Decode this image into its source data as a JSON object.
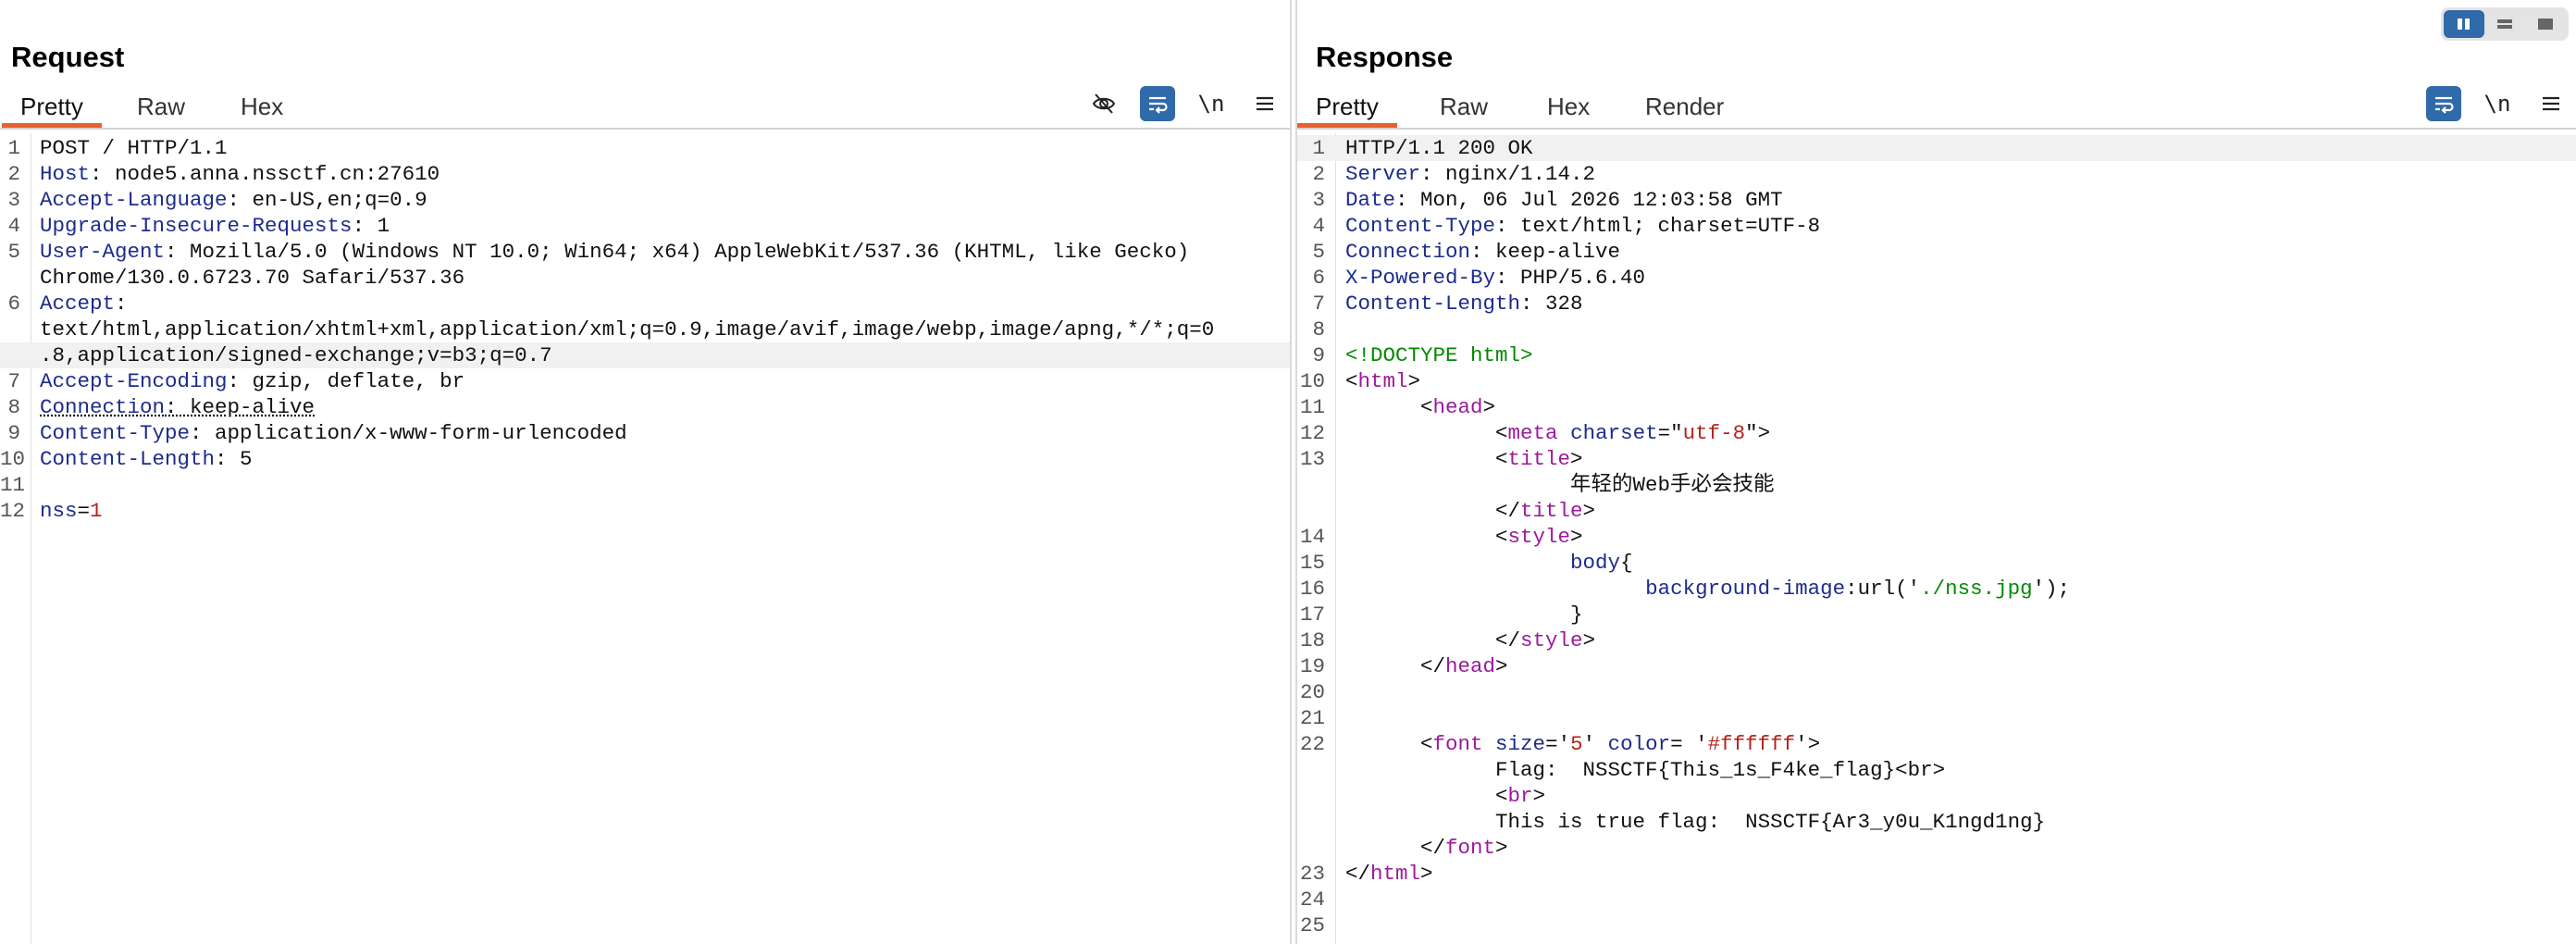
{
  "layout_switcher": {
    "icons": [
      "split-vertical-icon",
      "split-horizontal-icon",
      "single-pane-icon"
    ],
    "active": 0
  },
  "request": {
    "title": "Request",
    "tabs": [
      "Pretty",
      "Raw",
      "Hex"
    ],
    "active_tab": "Pretty",
    "tools": {
      "hide": "eye-slash-icon",
      "wrap": "wrap-icon",
      "newline": "\\n",
      "menu": "menu-icon"
    },
    "lines": [
      {
        "n": "1",
        "parts": [
          [
            "v",
            "POST / HTTP/1.1"
          ]
        ]
      },
      {
        "n": "2",
        "parts": [
          [
            "k",
            "Host"
          ],
          [
            "v",
            ": node5.anna.nssctf.cn:27610"
          ]
        ]
      },
      {
        "n": "3",
        "parts": [
          [
            "k",
            "Accept-Language"
          ],
          [
            "v",
            ": en-US,en;q=0.9"
          ]
        ]
      },
      {
        "n": "4",
        "parts": [
          [
            "k",
            "Upgrade-Insecure-Requests"
          ],
          [
            "v",
            ": 1"
          ]
        ]
      },
      {
        "n": "5",
        "parts": [
          [
            "k",
            "User-Agent"
          ],
          [
            "v",
            ": Mozilla/5.0 (Windows NT 10.0; Win64; x64) AppleWebKit/537.36 (KHTML, like Gecko)"
          ]
        ]
      },
      {
        "n": "",
        "parts": [
          [
            "v",
            "Chrome/130.0.6723.70 Safari/537.36"
          ]
        ]
      },
      {
        "n": "6",
        "parts": [
          [
            "k",
            "Accept"
          ],
          [
            "v",
            ":"
          ]
        ]
      },
      {
        "n": "",
        "parts": [
          [
            "v",
            "text/html,application/xhtml+xml,application/xml;q=0.9,image/avif,image/webp,image/apng,*/*;q=0"
          ]
        ]
      },
      {
        "n": "",
        "parts": [
          [
            "v",
            ".8,application/signed-exchange;v=b3;q=0.7"
          ]
        ],
        "hl": true
      },
      {
        "n": "7",
        "parts": [
          [
            "k",
            "Accept-Encoding"
          ],
          [
            "v",
            ": gzip, deflate, br"
          ]
        ]
      },
      {
        "n": "8",
        "parts": [
          [
            "k",
            "Connection"
          ],
          [
            "v",
            ": keep-alive"
          ]
        ],
        "dotted": true
      },
      {
        "n": "9",
        "parts": [
          [
            "k",
            "Content-Type"
          ],
          [
            "v",
            ": application/x-www-form-urlencoded"
          ]
        ]
      },
      {
        "n": "10",
        "parts": [
          [
            "k",
            "Content-Length"
          ],
          [
            "v",
            ": 5"
          ]
        ]
      },
      {
        "n": "11",
        "parts": []
      },
      {
        "n": "12",
        "parts": [
          [
            "k",
            "nss"
          ],
          [
            "v",
            "="
          ],
          [
            "num",
            "1"
          ]
        ]
      }
    ]
  },
  "response": {
    "title": "Response",
    "tabs": [
      "Pretty",
      "Raw",
      "Hex",
      "Render"
    ],
    "active_tab": "Pretty",
    "tools": {
      "wrap": "wrap-icon",
      "newline": "\\n",
      "menu": "menu-icon"
    },
    "lines": [
      {
        "n": "1",
        "parts": [
          [
            "v",
            "HTTP/1.1 200 OK"
          ]
        ],
        "hl": true
      },
      {
        "n": "2",
        "parts": [
          [
            "k",
            "Server"
          ],
          [
            "v",
            ": nginx/1.14.2"
          ]
        ]
      },
      {
        "n": "3",
        "parts": [
          [
            "k",
            "Date"
          ],
          [
            "v",
            ": Mon, 06 Jul 2026 12:03:58 GMT"
          ]
        ]
      },
      {
        "n": "4",
        "parts": [
          [
            "k",
            "Content-Type"
          ],
          [
            "v",
            ": text/html; charset=UTF-8"
          ]
        ]
      },
      {
        "n": "5",
        "parts": [
          [
            "k",
            "Connection"
          ],
          [
            "v",
            ": keep-alive"
          ]
        ]
      },
      {
        "n": "6",
        "parts": [
          [
            "k",
            "X-Powered-By"
          ],
          [
            "v",
            ": PHP/5.6.40"
          ]
        ]
      },
      {
        "n": "7",
        "parts": [
          [
            "k",
            "Content-Length"
          ],
          [
            "v",
            ": 328"
          ]
        ]
      },
      {
        "n": "8",
        "parts": []
      },
      {
        "n": "9",
        "parts": [
          [
            "doctype",
            "<!DOCTYPE html>"
          ]
        ]
      },
      {
        "n": "10",
        "parts": [
          [
            "v",
            "<"
          ],
          [
            "tag",
            "html"
          ],
          [
            "v",
            ">"
          ]
        ]
      },
      {
        "n": "11",
        "parts": [
          [
            "v",
            "      <"
          ],
          [
            "tag",
            "head"
          ],
          [
            "v",
            ">"
          ]
        ]
      },
      {
        "n": "12",
        "parts": [
          [
            "v",
            "            <"
          ],
          [
            "tag",
            "meta"
          ],
          [
            "v",
            " "
          ],
          [
            "attr",
            "charset"
          ],
          [
            "v",
            "=\""
          ],
          [
            "strr",
            "utf-8"
          ],
          [
            "v",
            "\">"
          ]
        ]
      },
      {
        "n": "13",
        "parts": [
          [
            "v",
            "            <"
          ],
          [
            "tag",
            "title"
          ],
          [
            "v",
            ">"
          ]
        ]
      },
      {
        "n": "",
        "parts": [
          [
            "v",
            "                  年轻的Web手必会技能"
          ]
        ]
      },
      {
        "n": "",
        "parts": [
          [
            "v",
            "            </"
          ],
          [
            "tag",
            "title"
          ],
          [
            "v",
            ">"
          ]
        ]
      },
      {
        "n": "14",
        "parts": [
          [
            "v",
            "            <"
          ],
          [
            "tag",
            "style"
          ],
          [
            "v",
            ">"
          ]
        ]
      },
      {
        "n": "15",
        "parts": [
          [
            "v",
            "                  "
          ],
          [
            "k",
            "body"
          ],
          [
            "v",
            "{"
          ]
        ]
      },
      {
        "n": "16",
        "parts": [
          [
            "v",
            "                        "
          ],
          [
            "k",
            "background-image"
          ],
          [
            "v",
            ":url('"
          ],
          [
            "str",
            "./nss.jpg"
          ],
          [
            "v",
            "');"
          ]
        ]
      },
      {
        "n": "17",
        "parts": [
          [
            "v",
            "                  }"
          ]
        ]
      },
      {
        "n": "18",
        "parts": [
          [
            "v",
            "            </"
          ],
          [
            "tag",
            "style"
          ],
          [
            "v",
            ">"
          ]
        ]
      },
      {
        "n": "19",
        "parts": [
          [
            "v",
            "      </"
          ],
          [
            "tag",
            "head"
          ],
          [
            "v",
            ">"
          ]
        ]
      },
      {
        "n": "20",
        "parts": []
      },
      {
        "n": "21",
        "parts": []
      },
      {
        "n": "22",
        "parts": [
          [
            "v",
            "      <"
          ],
          [
            "tag",
            "font"
          ],
          [
            "v",
            " "
          ],
          [
            "attr",
            "size"
          ],
          [
            "v",
            "='"
          ],
          [
            "strr",
            "5"
          ],
          [
            "v",
            "' "
          ],
          [
            "attr",
            "color"
          ],
          [
            "v",
            "= '"
          ],
          [
            "strr",
            "#ffffff"
          ],
          [
            "v",
            "'>"
          ]
        ]
      },
      {
        "n": "",
        "parts": [
          [
            "v",
            "            Flag:  NSSCTF{This_1s_F4ke_flag}<br>"
          ]
        ]
      },
      {
        "n": "",
        "parts": [
          [
            "v",
            "            <"
          ],
          [
            "tag",
            "br"
          ],
          [
            "v",
            ">"
          ]
        ]
      },
      {
        "n": "",
        "parts": [
          [
            "v",
            "            This is true flag:  NSSCTF{Ar3_y0u_K1ngd1ng}"
          ]
        ]
      },
      {
        "n": "",
        "parts": [
          [
            "v",
            "      </"
          ],
          [
            "tag",
            "font"
          ],
          [
            "v",
            ">"
          ]
        ]
      },
      {
        "n": "23",
        "parts": [
          [
            "v",
            "</"
          ],
          [
            "tag",
            "html"
          ],
          [
            "v",
            ">"
          ]
        ]
      },
      {
        "n": "24",
        "parts": []
      },
      {
        "n": "25",
        "parts": []
      }
    ]
  },
  "colors": {
    "accent": "#e8612c",
    "toggle_on": "#2f6aa9",
    "header_key": "#1c2c8c",
    "tag": "#9b1a9b",
    "string": "#008a00"
  }
}
